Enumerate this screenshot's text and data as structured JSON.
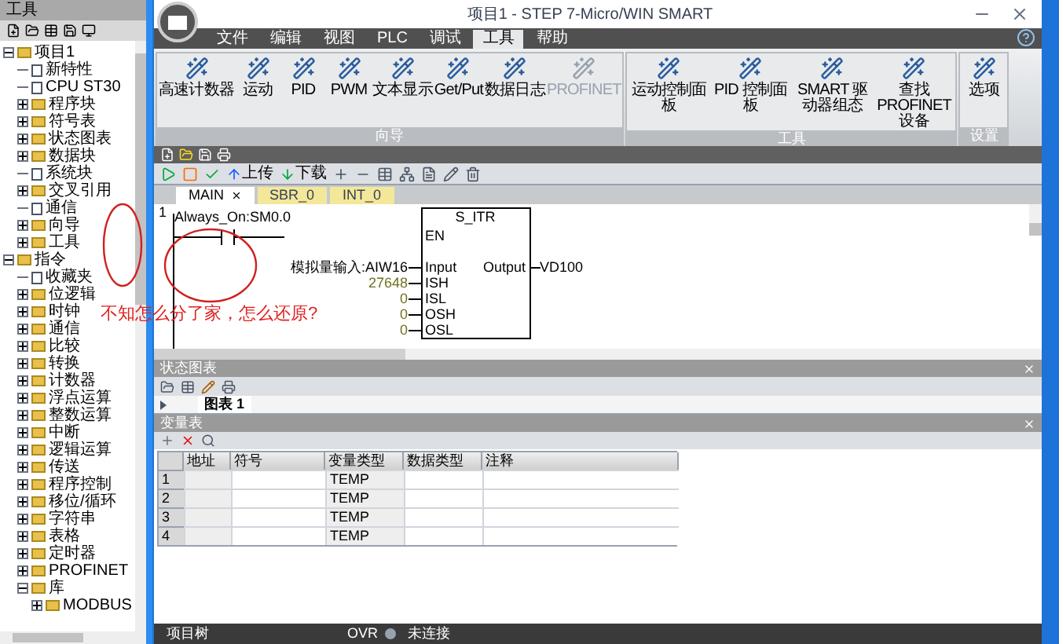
{
  "window": {
    "title": "项目1 - STEP 7-Micro/WIN SMART"
  },
  "sidebar": {
    "title": "工具",
    "tree": [
      {
        "label": "项目1",
        "kind": "folder",
        "expanded": true,
        "children": [
          {
            "label": "新特性",
            "kind": "leaf"
          },
          {
            "label": "CPU ST30",
            "kind": "leaf"
          },
          {
            "label": "程序块",
            "kind": "folder",
            "expanded": false
          },
          {
            "label": "符号表",
            "kind": "folder",
            "expanded": false
          },
          {
            "label": "状态图表",
            "kind": "folder",
            "expanded": false
          },
          {
            "label": "数据块",
            "kind": "folder",
            "expanded": false
          },
          {
            "label": "系统块",
            "kind": "leaf"
          },
          {
            "label": "交叉引用",
            "kind": "folder",
            "expanded": false
          },
          {
            "label": "通信",
            "kind": "leaf"
          },
          {
            "label": "向导",
            "kind": "folder",
            "expanded": false
          },
          {
            "label": "工具",
            "kind": "folder",
            "expanded": false
          }
        ]
      },
      {
        "label": "指令",
        "kind": "folder",
        "expanded": true,
        "children": [
          {
            "label": "收藏夹",
            "kind": "leaf"
          },
          {
            "label": "位逻辑",
            "kind": "folder",
            "expanded": false
          },
          {
            "label": "时钟",
            "kind": "folder",
            "expanded": false
          },
          {
            "label": "通信",
            "kind": "folder",
            "expanded": false
          },
          {
            "label": "比较",
            "kind": "folder",
            "expanded": false
          },
          {
            "label": "转换",
            "kind": "folder",
            "expanded": false
          },
          {
            "label": "计数器",
            "kind": "folder",
            "expanded": false
          },
          {
            "label": "浮点运算",
            "kind": "folder",
            "expanded": false
          },
          {
            "label": "整数运算",
            "kind": "folder",
            "expanded": false
          },
          {
            "label": "中断",
            "kind": "folder",
            "expanded": false
          },
          {
            "label": "逻辑运算",
            "kind": "folder",
            "expanded": false
          },
          {
            "label": "传送",
            "kind": "folder",
            "expanded": false
          },
          {
            "label": "程序控制",
            "kind": "folder",
            "expanded": false
          },
          {
            "label": "移位/循环",
            "kind": "folder",
            "expanded": false
          },
          {
            "label": "字符串",
            "kind": "folder",
            "expanded": false
          },
          {
            "label": "表格",
            "kind": "folder",
            "expanded": false
          },
          {
            "label": "定时器",
            "kind": "folder",
            "expanded": false
          },
          {
            "label": "PROFINET",
            "kind": "folder",
            "expanded": false
          },
          {
            "label": "库",
            "kind": "folder",
            "expanded": true,
            "children": [
              {
                "label": "MODBUS",
                "kind": "folder",
                "expanded": false
              }
            ]
          }
        ]
      }
    ]
  },
  "menu_tabs": [
    {
      "label": "文件",
      "selected": false
    },
    {
      "label": "编辑",
      "selected": false
    },
    {
      "label": "视图",
      "selected": false
    },
    {
      "label": "PLC",
      "selected": false
    },
    {
      "label": "调试",
      "selected": false
    },
    {
      "label": "工具",
      "selected": true
    },
    {
      "label": "帮助",
      "selected": false
    }
  ],
  "ribbon_groups": [
    {
      "title": "向导",
      "buttons": [
        {
          "label": "高速计数器",
          "disabled": false
        },
        {
          "label": "运动",
          "disabled": false
        },
        {
          "label": "PID",
          "disabled": false
        },
        {
          "label": "PWM",
          "disabled": false
        },
        {
          "label": "文本显示",
          "disabled": false
        },
        {
          "label": "Get/Put",
          "disabled": false
        },
        {
          "label": "数据日志",
          "disabled": false
        },
        {
          "label": "PROFINET",
          "disabled": true
        }
      ]
    },
    {
      "title": "工具",
      "buttons": [
        {
          "label": "运动控制面板",
          "disabled": false
        },
        {
          "label": "PID 控制面板",
          "disabled": false
        },
        {
          "label": "SMART 驱动器组态",
          "disabled": false
        },
        {
          "label": "查找 PROFINET 设备",
          "disabled": false
        }
      ]
    },
    {
      "title": "设置",
      "buttons": [
        {
          "label": "选项",
          "disabled": false
        }
      ]
    }
  ],
  "toolbar": {
    "upload": "上传",
    "download": "下载"
  },
  "editor": {
    "tabs": [
      {
        "label": "MAIN",
        "selected": true,
        "closable": true
      },
      {
        "label": "SBR_0",
        "selected": false,
        "closable": false
      },
      {
        "label": "INT_0",
        "selected": false,
        "closable": false
      }
    ],
    "network": "1",
    "contact": "Always_On:SM0.0",
    "box_title": "S_ITR",
    "enable_pin": "EN",
    "inputs": [
      {
        "value": "模拟量输入:AIW16",
        "pin": "Input"
      },
      {
        "value": "27648",
        "pin": "ISH"
      },
      {
        "value": "0",
        "pin": "ISL"
      },
      {
        "value": "0",
        "pin": "OSH"
      },
      {
        "value": "0",
        "pin": "OSL"
      }
    ],
    "output": {
      "pin": "Output",
      "value": "VD100"
    }
  },
  "annotation": "不知怎么分了家，怎么还原?",
  "status_chart": {
    "title": "状态图表",
    "tabs": [
      {
        "label": "图表 1",
        "selected": true
      }
    ]
  },
  "var_table": {
    "title": "变量表",
    "columns": [
      "地址",
      "符号",
      "变量类型",
      "数据类型",
      "注释"
    ],
    "rows": [
      {
        "number": "1",
        "var_type": "TEMP"
      },
      {
        "number": "2",
        "var_type": "TEMP"
      },
      {
        "number": "3",
        "var_type": "TEMP"
      },
      {
        "number": "4",
        "var_type": "TEMP"
      }
    ]
  },
  "status_bar": {
    "left": "项目树",
    "mode": "OVR",
    "connection": "未连接"
  }
}
